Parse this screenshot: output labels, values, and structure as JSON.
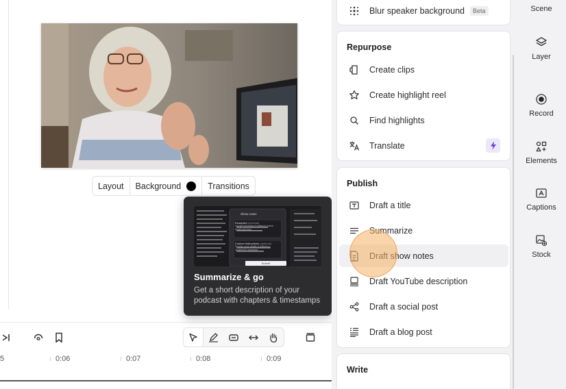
{
  "scene_toolbar": {
    "layout": "Layout",
    "background": "Background",
    "background_color": "#000000",
    "transitions": "Transitions"
  },
  "timeline": {
    "ticks": [
      "5",
      "0:06",
      "0:07",
      "0:08",
      "0:09"
    ]
  },
  "tooltip": {
    "title": "Summarize & go",
    "description": "Get a short description of your podcast with chapters & timestamps",
    "preview": {
      "header": "Show notes",
      "examples_label": "Examples",
      "examples_optional": "(optional)",
      "examples_text": "Include elements of writing to match length and tone",
      "custom_label": "Custom instructions",
      "custom_optional": "(optional)",
      "custom_text": "Provide more details to influence Underlord's response",
      "submit": "Submit"
    }
  },
  "panel": {
    "top_item": {
      "label": "Blur speaker background",
      "badge": "Beta"
    },
    "repurpose": {
      "title": "Repurpose",
      "items": [
        {
          "label": "Create clips",
          "icon": "clips-icon"
        },
        {
          "label": "Create highlight reel",
          "icon": "star-icon"
        },
        {
          "label": "Find highlights",
          "icon": "search-icon"
        },
        {
          "label": "Translate",
          "icon": "translate-icon"
        }
      ]
    },
    "publish": {
      "title": "Publish",
      "items": [
        {
          "label": "Draft a title",
          "icon": "title-icon"
        },
        {
          "label": "Summarize",
          "icon": "summarize-icon"
        },
        {
          "label": "Draft show notes",
          "icon": "document-icon"
        },
        {
          "label": "Draft YouTube description",
          "icon": "youtube-description-icon"
        },
        {
          "label": "Draft a social post",
          "icon": "share-icon"
        },
        {
          "label": "Draft a blog post",
          "icon": "blog-icon"
        }
      ]
    },
    "write": {
      "title": "Write"
    }
  },
  "rail": {
    "items": [
      {
        "label": "Scene"
      },
      {
        "label": "Layer"
      },
      {
        "label": "Record"
      },
      {
        "label": "Elements"
      },
      {
        "label": "Captions"
      },
      {
        "label": "Stock"
      }
    ]
  },
  "colors": {
    "accent_purple": "#6d3fd6",
    "hover_ring": "#f5b064",
    "tooltip_bg": "#2d2d2f"
  }
}
